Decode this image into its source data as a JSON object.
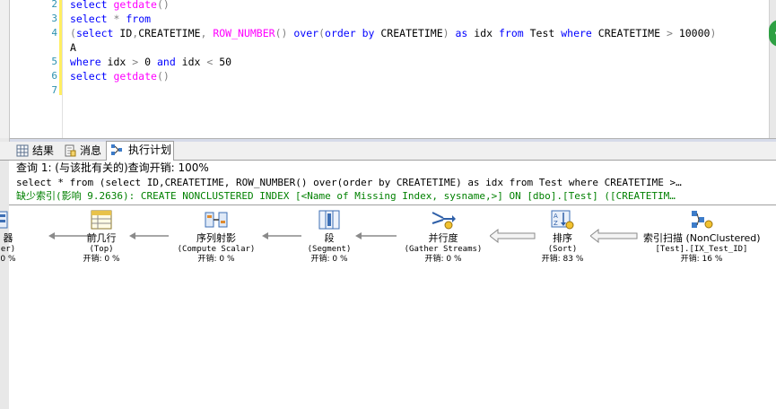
{
  "editor": {
    "lines": [
      {
        "num": "2",
        "text": "select getdate()"
      },
      {
        "num": "3",
        "text": "select * from"
      },
      {
        "num": "4",
        "text": "(select ID,CREATETIME, ROW_NUMBER() over(order by CREATETIME) as idx from Test where CREATETIME > 10000)"
      },
      {
        "num": "",
        "text": "A"
      },
      {
        "num": "5",
        "text": "where idx > 0 and idx < 50"
      },
      {
        "num": "6",
        "text": "select getdate()"
      },
      {
        "num": "7",
        "text": ""
      }
    ]
  },
  "tabs": [
    {
      "label": "结果",
      "icon": "grid-icon"
    },
    {
      "label": "消息",
      "icon": "message-icon"
    },
    {
      "label": "执行计划",
      "icon": "execution-plan-icon",
      "active": true
    }
  ],
  "plan": {
    "query_header": "查询 1: (与该批有关的)查询开销: 100%",
    "query_text": "select * from (select ID,CREATETIME, ROW_NUMBER() over(order by CREATETIME) as idx from Test where CREATETIME >…",
    "missing_index": "缺少索引(影响 9.2636): CREATE NONCLUSTERED INDEX [<Name of Missing Index, sysname,>] ON [dbo].[Test] ([CREATETIM…",
    "nodes": [
      {
        "name": "器",
        "sub": "er)",
        "cost": "0 %",
        "icon": "filter-icon"
      },
      {
        "name": "前几行",
        "sub": "(Top)",
        "cost": "开销: 0 %",
        "icon": "top-icon"
      },
      {
        "name": "序列射影",
        "sub": "(Compute Scalar)",
        "cost": "开销: 0 %",
        "icon": "compute-scalar-icon"
      },
      {
        "name": "段",
        "sub": "(Segment)",
        "cost": "开销: 0 %",
        "icon": "segment-icon"
      },
      {
        "name": "并行度",
        "sub": "(Gather Streams)",
        "cost": "开销: 0 %",
        "icon": "gather-streams-icon"
      },
      {
        "name": "排序",
        "sub": "(Sort)",
        "cost": "开销: 83 %",
        "icon": "sort-icon"
      },
      {
        "name": "索引扫描 (NonClustered)",
        "sub": "[Test].[IX_Test_ID]",
        "cost": "开销: 16 %",
        "icon": "index-scan-icon"
      }
    ]
  },
  "colors": {
    "keyword": "#0000ff",
    "function": "#ff00ff",
    "operator": "#808080",
    "missing_index": "#008000",
    "line_numbers": "#2b91af"
  }
}
